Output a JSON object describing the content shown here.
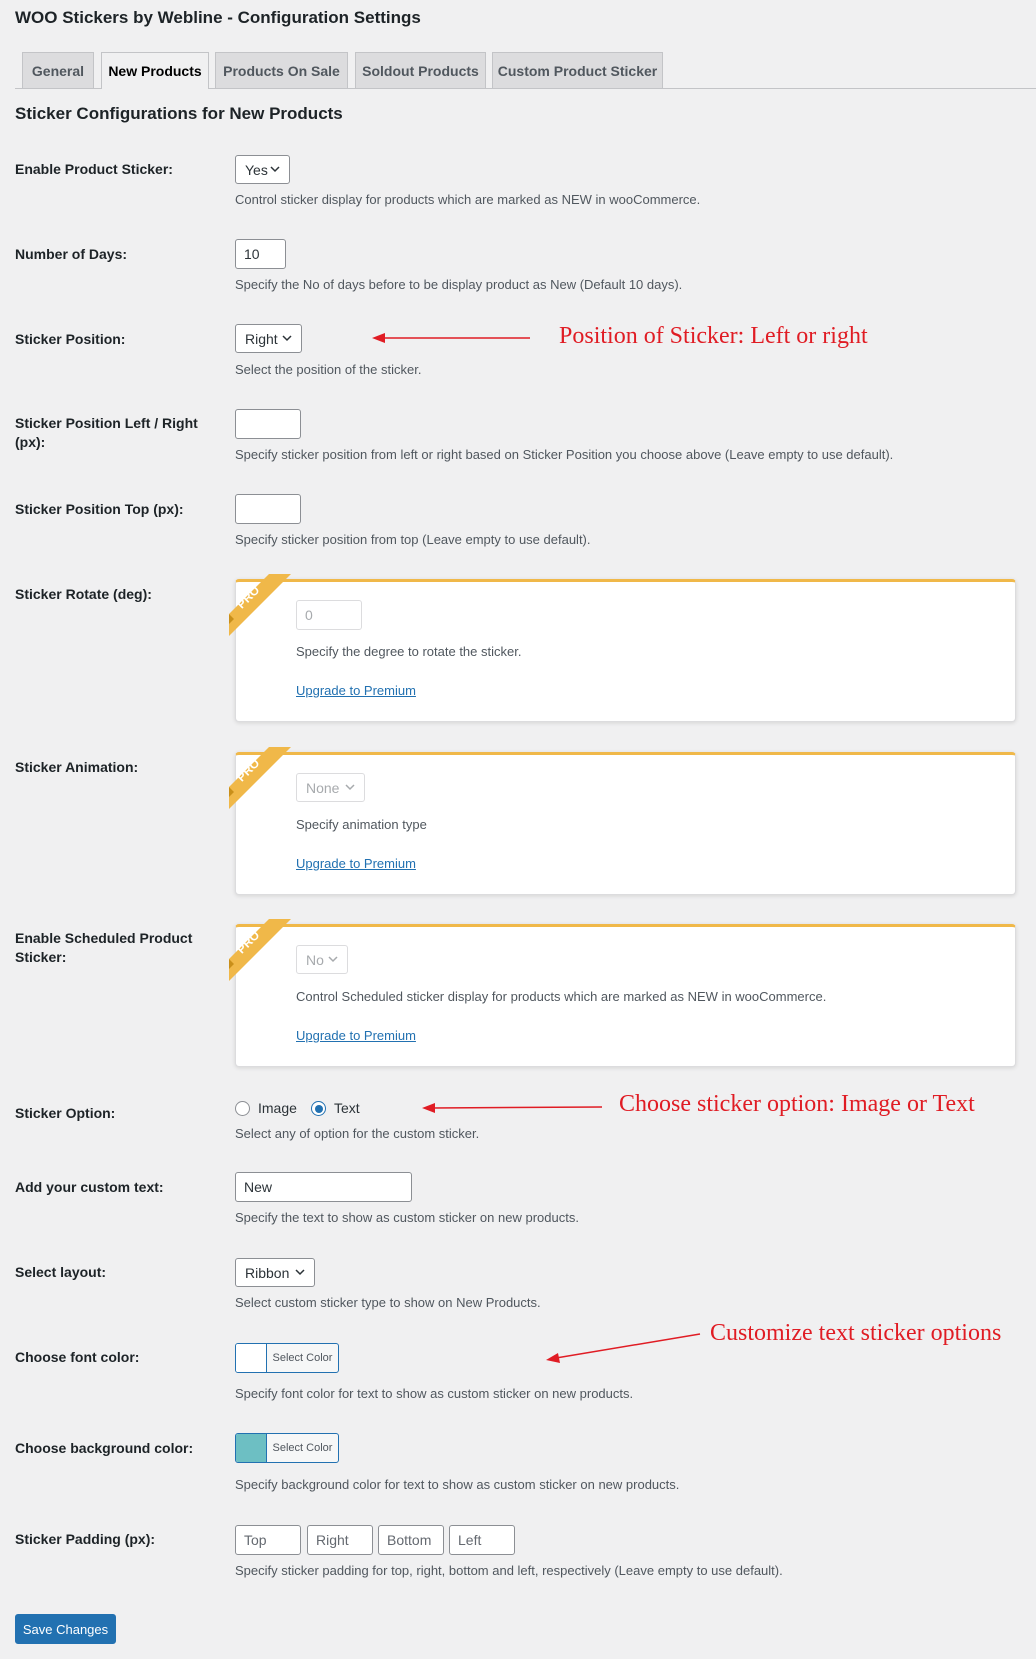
{
  "page": {
    "title": "WOO Stickers by Webline - Configuration Settings",
    "section_title": "Sticker Configurations for New Products"
  },
  "tabs": [
    {
      "label": "General",
      "active": false
    },
    {
      "label": "New Products",
      "active": true
    },
    {
      "label": "Products On Sale",
      "active": false
    },
    {
      "label": "Soldout Products",
      "active": false
    },
    {
      "label": "Custom Product Sticker",
      "active": false
    }
  ],
  "fields": {
    "enable_sticker": {
      "label": "Enable Product Sticker:",
      "value": "Yes",
      "desc": "Control sticker display for products which are marked as NEW in wooCommerce."
    },
    "num_days": {
      "label": "Number of Days:",
      "value": "10",
      "desc": "Specify the No of days before to be display product as New (Default 10 days)."
    },
    "position": {
      "label": "Sticker Position:",
      "value": "Right",
      "desc": "Select the position of the sticker."
    },
    "position_lr": {
      "label": "Sticker Position Left / Right (px):",
      "value": "",
      "desc": "Specify sticker position from left or right based on Sticker Position you choose above (Leave empty to use default)."
    },
    "position_top": {
      "label": "Sticker Position Top (px):",
      "value": "",
      "desc": "Specify sticker position from top (Leave empty to use default)."
    },
    "rotate": {
      "label": "Sticker Rotate (deg):",
      "placeholder": "0",
      "desc": "Specify the degree to rotate the sticker.",
      "link": "Upgrade to Premium"
    },
    "animation": {
      "label": "Sticker Animation:",
      "value": "None",
      "desc": "Specify animation type",
      "link": "Upgrade to Premium"
    },
    "scheduled": {
      "label": "Enable Scheduled Product Sticker:",
      "value": "No",
      "desc": "Control Scheduled sticker display for products which are marked as NEW in wooCommerce.",
      "link": "Upgrade to Premium"
    },
    "sticker_option": {
      "label": "Sticker Option:",
      "options": [
        "Image",
        "Text"
      ],
      "selected": "Text",
      "desc": "Select any of option for the custom sticker."
    },
    "custom_text": {
      "label": "Add your custom text:",
      "value": "New",
      "desc": "Specify the text to show as custom sticker on new products."
    },
    "layout": {
      "label": "Select layout:",
      "value": "Ribbon",
      "desc": "Select custom sticker type to show on New Products."
    },
    "font_color": {
      "label": "Choose font color:",
      "button": "Select Color",
      "color": "#ffffff",
      "desc": "Specify font color for text to show as custom sticker on new products."
    },
    "bg_color": {
      "label": "Choose background color:",
      "button": "Select Color",
      "color": "#6dbfc3",
      "desc": "Specify background color for text to show as custom sticker on new products."
    },
    "padding": {
      "label": "Sticker Padding (px):",
      "placeholders": [
        "Top",
        "Right",
        "Bottom",
        "Left"
      ],
      "desc": "Specify sticker padding for top, right, bottom and left, respectively (Leave empty to use default)."
    }
  },
  "pro_badge": "PRO",
  "save_button": "Save Changes",
  "annotations": {
    "position": "Position of Sticker: Left or right",
    "option": "Choose sticker option: Image or Text",
    "text_options": "Customize text sticker options"
  },
  "colors": {
    "accent": "#2271b1",
    "pro_ribbon": "#f0b849",
    "annotation": "#e01c24"
  }
}
